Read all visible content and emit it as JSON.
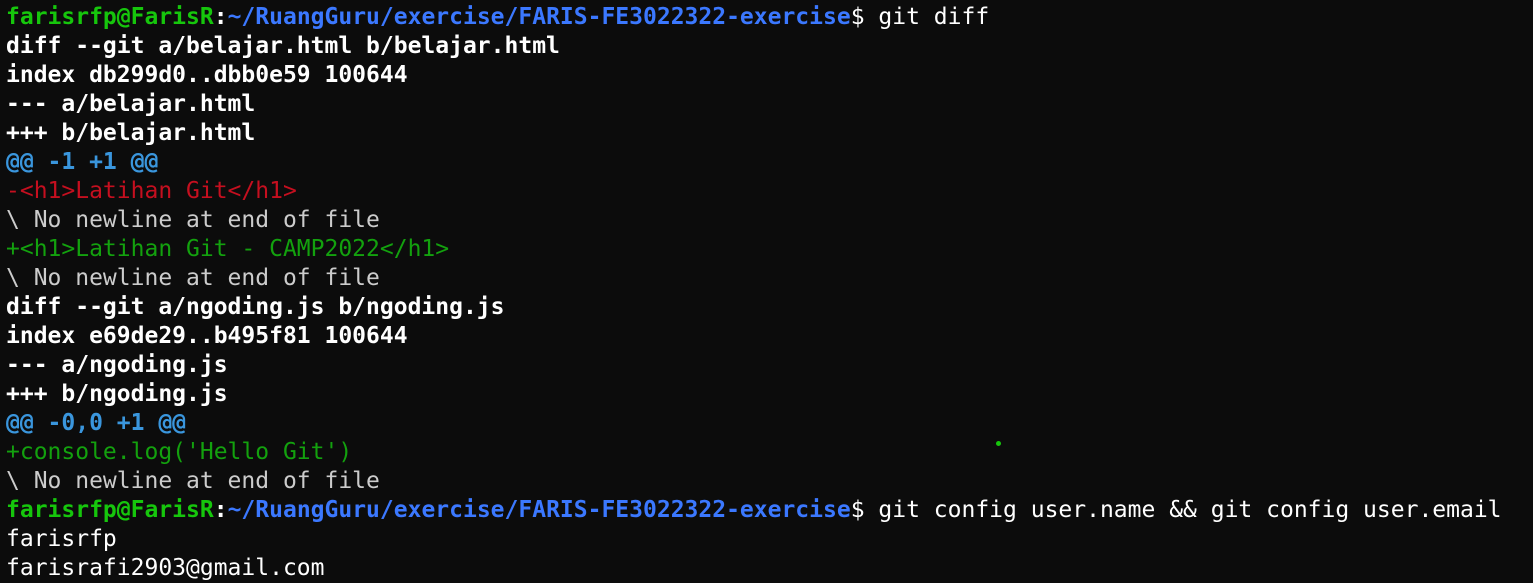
{
  "prompt": {
    "user_host": "farisrfp@FarisR",
    "separator": ":",
    "path": "~/RuangGuru/exercise/FARIS-FE3022322-exercise",
    "symbol": "$"
  },
  "commands": {
    "first": " git diff",
    "second": " git config user.name && git config user.email"
  },
  "diff": {
    "file1": {
      "header": "diff --git a/belajar.html b/belajar.html",
      "index": "index db299d0..dbb0e59 100644",
      "minus": "--- a/belajar.html",
      "plus": "+++ b/belajar.html",
      "hunk": "@@ -1 +1 @@",
      "removed": "-<h1>Latihan Git</h1>",
      "no_newline_1": "\\ No newline at end of file",
      "added": "+<h1>Latihan Git - CAMP2022</h1>",
      "no_newline_2": "\\ No newline at end of file"
    },
    "file2": {
      "header": "diff --git a/ngoding.js b/ngoding.js",
      "index": "index e69de29..b495f81 100644",
      "minus": "--- a/ngoding.js",
      "plus": "+++ b/ngoding.js",
      "hunk": "@@ -0,0 +1 @@",
      "added": "+console.log('Hello Git')",
      "no_newline": "\\ No newline at end of file"
    }
  },
  "config_output": {
    "name": "farisrfp",
    "email": "farisrafi2903@gmail.com"
  }
}
